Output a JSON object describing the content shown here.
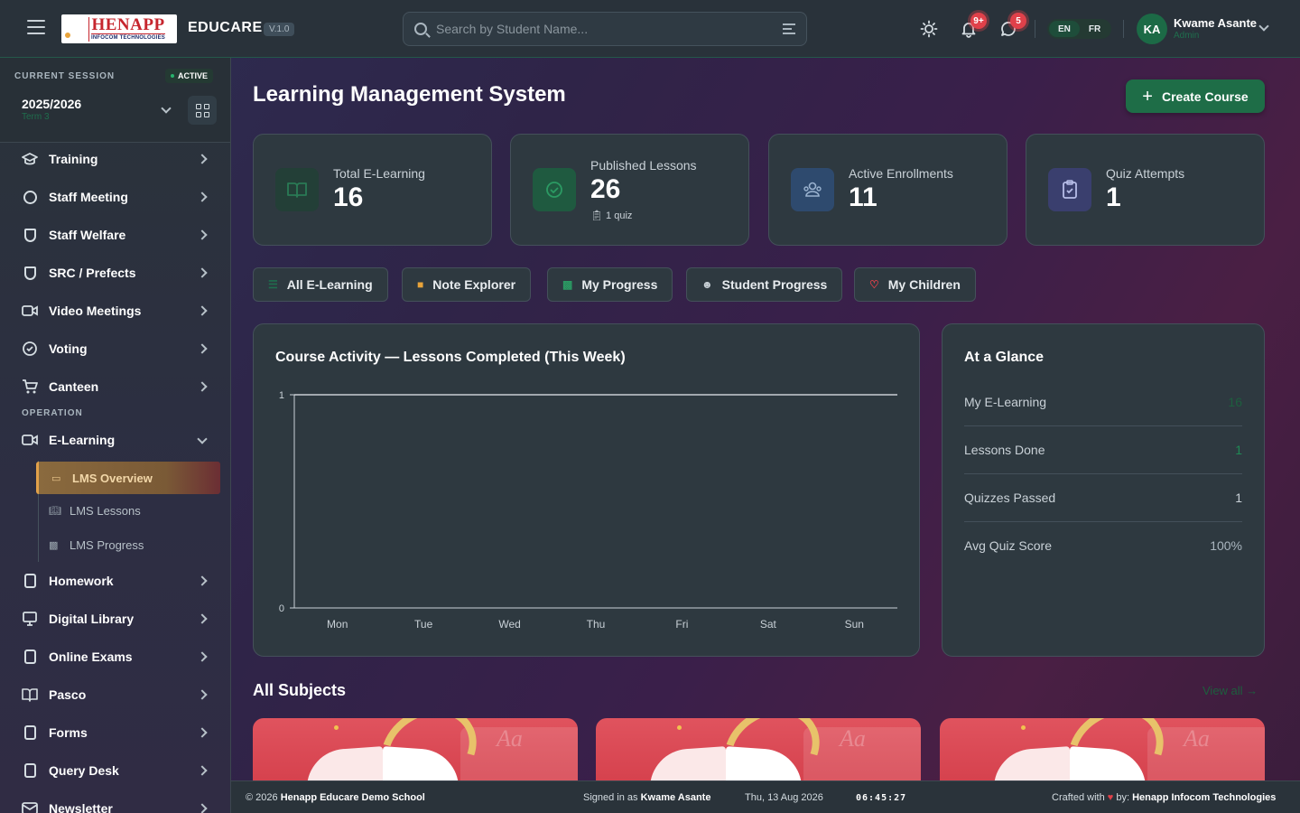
{
  "topbar": {
    "logo_main": "HENAPP",
    "logo_sub": "INFOCOM TECHNOLOGIES",
    "brand": "EDUCARE",
    "version": "V.1.0",
    "search_placeholder": "Search by Student Name...",
    "notifications_badge": "9+",
    "messages_badge": "5",
    "lang_en": "EN",
    "lang_fr": "FR",
    "avatar_initials": "KA",
    "user_name": "Kwame Asante",
    "user_role": "Admin"
  },
  "session": {
    "label": "CURRENT SESSION",
    "status": "ACTIVE",
    "year": "2025/2026",
    "term": "Term 3"
  },
  "sidebar": {
    "items_top": [
      {
        "label": "Training",
        "icon": "graduation-cap-icon"
      },
      {
        "label": "Staff Meeting",
        "icon": "chat-bubble-icon"
      },
      {
        "label": "Staff Welfare",
        "icon": "shield-icon"
      },
      {
        "label": "SRC / Prefects",
        "icon": "shield-check-icon"
      },
      {
        "label": "Video Meetings",
        "icon": "video-icon"
      },
      {
        "label": "Voting",
        "icon": "check-circle-icon"
      },
      {
        "label": "Canteen",
        "icon": "cart-icon"
      }
    ],
    "section_operation": "OPERATION",
    "elearning": "E-Learning",
    "sub_items": [
      {
        "label": "LMS Overview",
        "icon": "video-icon"
      },
      {
        "label": "LMS Lessons",
        "icon": "book-icon"
      },
      {
        "label": "LMS Progress",
        "icon": "bar-chart-icon"
      }
    ],
    "items_bottom": [
      {
        "label": "Homework",
        "icon": "document-icon"
      },
      {
        "label": "Digital Library",
        "icon": "monitor-icon"
      },
      {
        "label": "Online Exams",
        "icon": "document-icon"
      },
      {
        "label": "Pasco",
        "icon": "book-open-icon"
      },
      {
        "label": "Forms",
        "icon": "clipboard-icon"
      },
      {
        "label": "Query Desk",
        "icon": "document-icon"
      },
      {
        "label": "Newsletter",
        "icon": "mail-icon"
      }
    ]
  },
  "main": {
    "title": "Learning Management System",
    "create_button": "Create Course",
    "stats": [
      {
        "label": "Total E-Learning",
        "value": "16",
        "icon": "book-icon",
        "color": "#1f4a3a"
      },
      {
        "label": "Published Lessons",
        "value": "26",
        "sub": "1 quiz",
        "icon": "check-circle-icon",
        "color": "#1f5a40"
      },
      {
        "label": "Active Enrollments",
        "value": "11",
        "icon": "users-icon",
        "color": "#2e4a6e"
      },
      {
        "label": "Quiz Attempts",
        "value": "1",
        "icon": "clipboard-check-icon",
        "color": "#3a3f6e"
      }
    ],
    "tabs": [
      {
        "label": "All E-Learning",
        "icon": "list-icon"
      },
      {
        "label": "Note Explorer",
        "icon": "folder-icon"
      },
      {
        "label": "My Progress",
        "icon": "bar-chart-icon"
      },
      {
        "label": "Student Progress",
        "icon": "users-icon"
      },
      {
        "label": "My Children",
        "icon": "heart-icon"
      }
    ],
    "glance": {
      "title": "At a Glance",
      "rows": [
        {
          "label": "My E-Learning",
          "value": "16",
          "color": "#1d5f3e"
        },
        {
          "label": "Lessons Done",
          "value": "1",
          "color": "#1f8a55"
        },
        {
          "label": "Quizzes Passed",
          "value": "1",
          "color": "#c9d1d7"
        },
        {
          "label": "Avg Quiz Score",
          "value": "100%",
          "color": "#aab6bf"
        }
      ]
    },
    "subjects_title": "All Subjects",
    "view_all": "View all →"
  },
  "chart_data": {
    "type": "line",
    "title": "Course Activity — Lessons Completed (This Week)",
    "categories": [
      "Mon",
      "Tue",
      "Wed",
      "Thu",
      "Fri",
      "Sat",
      "Sun"
    ],
    "values": [
      0,
      0,
      0,
      0,
      0,
      0,
      0
    ],
    "yticks": [
      "1",
      "0"
    ],
    "ylim": [
      0,
      1
    ],
    "grid": true,
    "legend": "none"
  },
  "footer": {
    "copyright_prefix": "© 2026",
    "school": "Henapp Educare Demo School",
    "signed_prefix": "Signed in as",
    "signed_user": "Kwame Asante",
    "date": "Thu, 13 Aug 2026",
    "time": "06:45:27",
    "crafted_prefix": "Crafted with",
    "heart": "♥",
    "crafted_by": "by:",
    "company": "Henapp Infocom Technologies"
  }
}
